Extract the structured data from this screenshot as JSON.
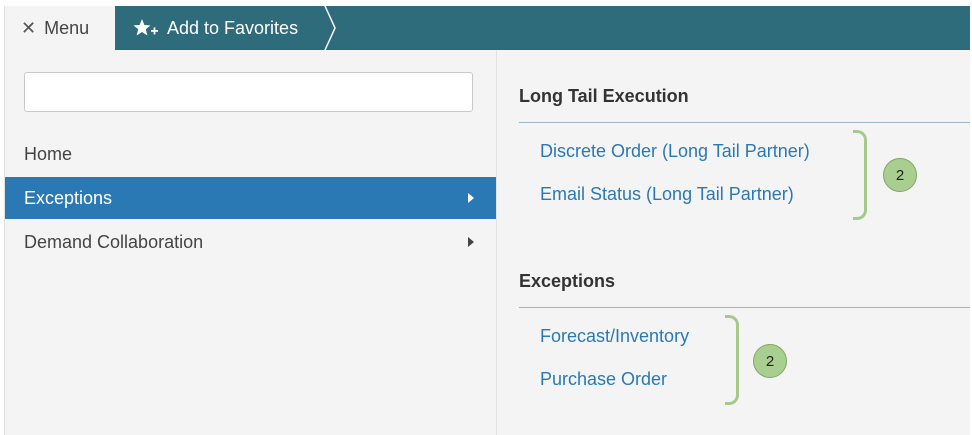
{
  "topbar": {
    "menu_label": "Menu",
    "close_icon": "✕",
    "favorites_label": "Add to Favorites",
    "favorites_icon": "star-plus-icon",
    "bar_color": "#2e6b7b"
  },
  "search": {
    "value": "",
    "placeholder": ""
  },
  "nav": {
    "items": [
      {
        "label": "Home",
        "has_arrow": false,
        "active": false
      },
      {
        "label": "Exceptions",
        "has_arrow": true,
        "active": true
      },
      {
        "label": "Demand Collaboration",
        "has_arrow": true,
        "active": false
      }
    ],
    "active_color": "#2a79b5"
  },
  "sections": [
    {
      "title": "Long Tail Execution",
      "links": [
        "Discrete Order (Long Tail Partner)",
        "Email Status (Long Tail Partner)"
      ],
      "badge": "2"
    },
    {
      "title": "Exceptions",
      "links": [
        "Forecast/Inventory",
        "Purchase Order"
      ],
      "badge": "2"
    }
  ],
  "annotation_color": "#a8cf8f"
}
